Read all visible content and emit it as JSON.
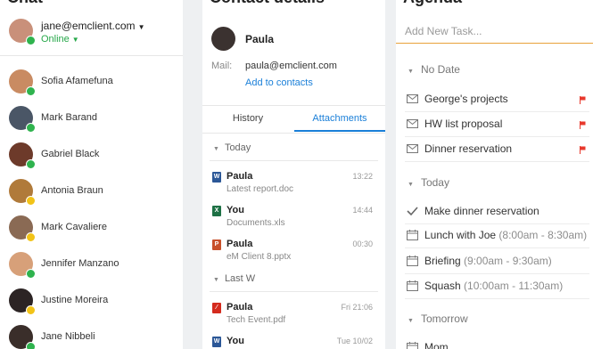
{
  "chat": {
    "title": "Chat",
    "me": {
      "email": "jane@emclient.com",
      "status": "Online"
    },
    "contacts": [
      {
        "name": "Sofia Afamefuna",
        "status": "online",
        "avatar_color": "#c98b62"
      },
      {
        "name": "Mark Barand",
        "status": "online",
        "avatar_color": "#4a5666"
      },
      {
        "name": "Gabriel Black",
        "status": "online",
        "avatar_color": "#6d3a2a"
      },
      {
        "name": "Antonia Braun",
        "status": "away",
        "avatar_color": "#b07a3a"
      },
      {
        "name": "Mark Cavaliere",
        "status": "away",
        "avatar_color": "#8a6a54"
      },
      {
        "name": "Jennifer Manzano",
        "status": "online",
        "avatar_color": "#d7a079"
      },
      {
        "name": "Justine Moreira",
        "status": "away",
        "avatar_color": "#2c2424"
      },
      {
        "name": "Jane Nibbeli",
        "status": "online",
        "avatar_color": "#3a2e2a"
      }
    ]
  },
  "contact_details": {
    "title": "Contact details",
    "name": "Paula",
    "mail_label": "Mail:",
    "email": "paula@emclient.com",
    "add_link": "Add to contacts",
    "tabs": [
      {
        "label": "History"
      },
      {
        "label": "Attachments",
        "active": true
      }
    ],
    "groups": [
      {
        "label": "Today",
        "items": [
          {
            "sender": "Paula",
            "file": "Latest report.doc",
            "date": "13:22",
            "type": "doc",
            "color": "#2b5797"
          },
          {
            "sender": "You",
            "file": "Documents.xls",
            "date": "14:44",
            "type": "xls",
            "color": "#1e7145"
          },
          {
            "sender": "Paula",
            "file": "eM Client 8.pptx",
            "date": "00:30",
            "type": "ppt",
            "color": "#c8502a"
          }
        ]
      },
      {
        "label": "Last W",
        "items": [
          {
            "sender": "Paula",
            "file": "Tech Event.pdf",
            "date": "Fri 21:06",
            "type": "pdf",
            "color": "#d42b1e"
          },
          {
            "sender": "You",
            "file": "",
            "date": "Tue 10/02",
            "type": "doc",
            "color": "#2b5797"
          }
        ]
      }
    ]
  },
  "agenda": {
    "title": "Agenda",
    "new_task_placeholder": "Add New Task...",
    "flag_color": "#e8382c",
    "accent": "#e8a23a",
    "groups": [
      {
        "label": "No Date",
        "items": [
          {
            "text": "George's projects",
            "time": "",
            "icon": "mail-icon",
            "flag": true
          },
          {
            "text": "HW list proposal",
            "time": "",
            "icon": "mail-icon",
            "flag": true
          },
          {
            "text": "Dinner reservation",
            "time": "",
            "icon": "mail-icon",
            "flag": true
          }
        ]
      },
      {
        "label": "Today",
        "items": [
          {
            "text": "Make dinner reservation",
            "time": "",
            "icon": "check-icon",
            "flag": false
          },
          {
            "text": "Lunch with Joe",
            "time": "(8:00am - 8:30am)",
            "icon": "calendar-icon",
            "flag": false
          },
          {
            "text": "Briefing",
            "time": "(9:00am - 9:30am)",
            "icon": "calendar-icon",
            "flag": false
          },
          {
            "text": "Squash",
            "time": "(10:00am - 11:30am)",
            "icon": "calendar-icon",
            "flag": false
          }
        ]
      },
      {
        "label": "Tomorrow",
        "items": [
          {
            "text": "Mom",
            "time": "",
            "icon": "calendar-icon",
            "flag": false
          }
        ]
      }
    ]
  }
}
